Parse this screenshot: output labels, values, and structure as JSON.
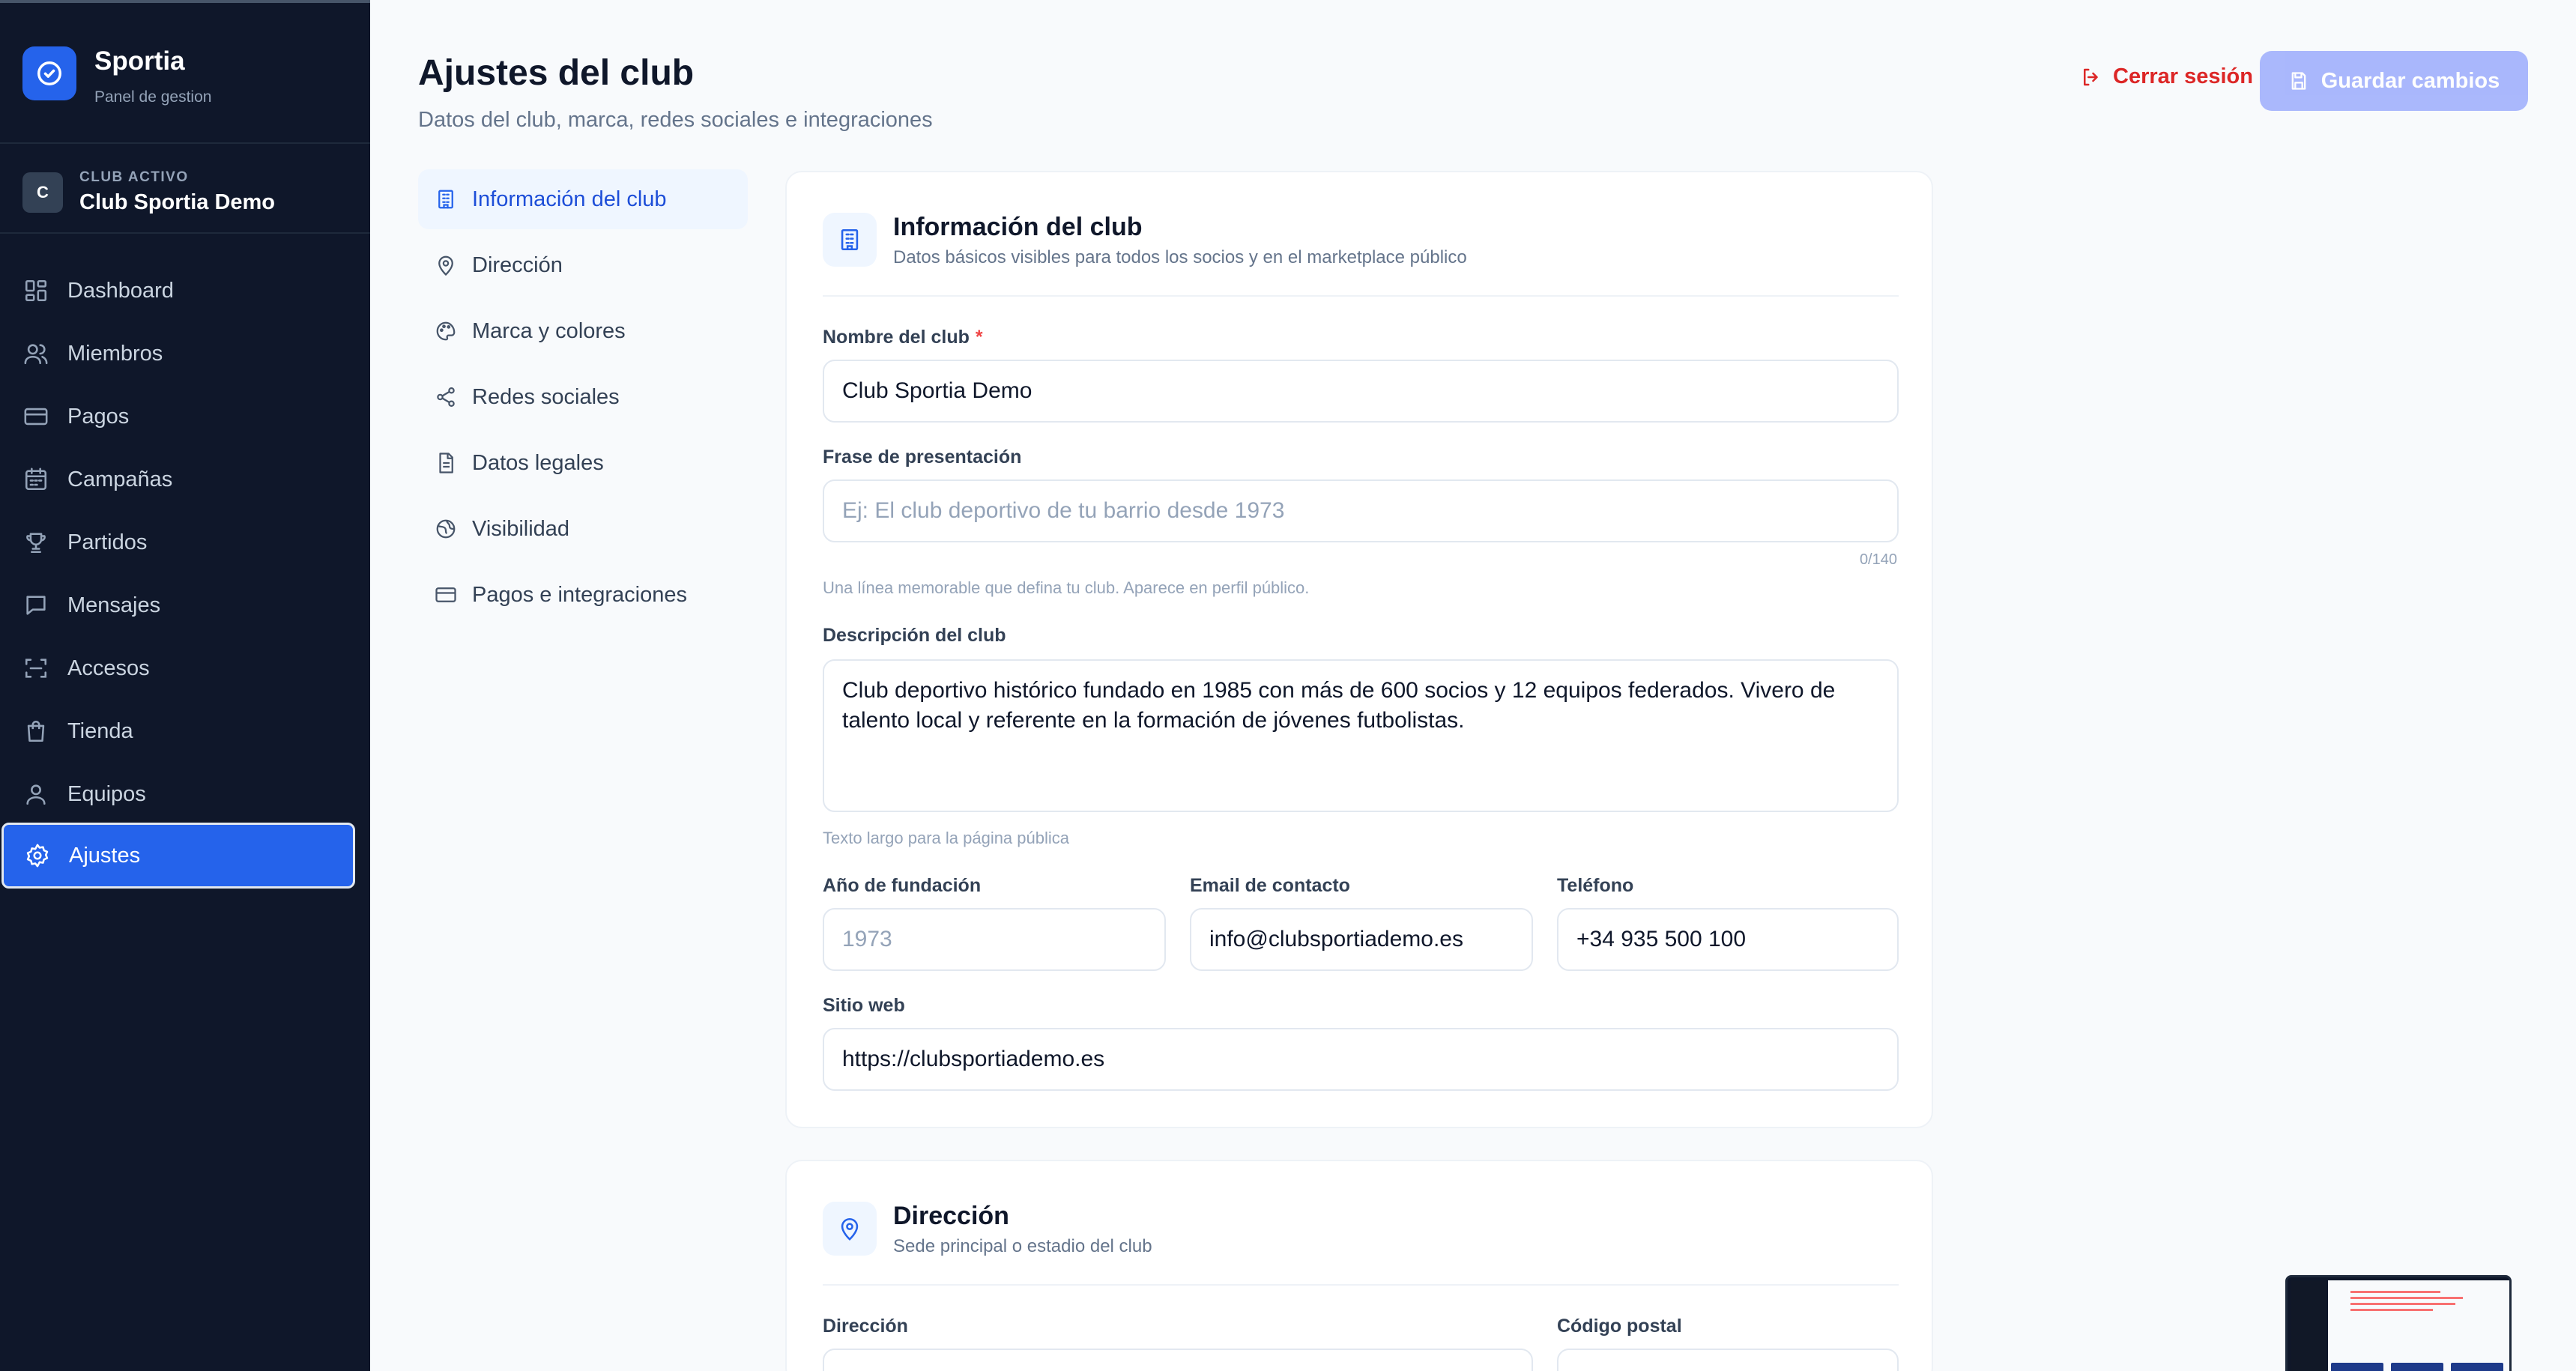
{
  "brand": {
    "name": "Sportia",
    "subtitle": "Panel de gestion"
  },
  "club": {
    "initial": "C",
    "label": "CLUB ACTIVO",
    "name": "Club Sportia Demo"
  },
  "sidebar": {
    "items": [
      {
        "label": "Dashboard",
        "icon": "dashboard-icon"
      },
      {
        "label": "Miembros",
        "icon": "users-icon"
      },
      {
        "label": "Pagos",
        "icon": "credit-card-icon"
      },
      {
        "label": "Campañas",
        "icon": "calendar-icon"
      },
      {
        "label": "Partidos",
        "icon": "trophy-icon"
      },
      {
        "label": "Mensajes",
        "icon": "message-icon"
      },
      {
        "label": "Accesos",
        "icon": "scan-icon"
      },
      {
        "label": "Tienda",
        "icon": "shopping-bag-icon"
      },
      {
        "label": "Equipos",
        "icon": "user-icon"
      },
      {
        "label": "Ajustes",
        "icon": "gear-icon",
        "active": true
      }
    ]
  },
  "header": {
    "title": "Ajustes del club",
    "subtitle": "Datos del club, marca, redes sociales e integraciones",
    "logout_label": "Cerrar sesión",
    "save_label": "Guardar cambios"
  },
  "section_nav": [
    {
      "label": "Información del club",
      "icon": "building-icon",
      "active": true
    },
    {
      "label": "Dirección",
      "icon": "map-pin-icon"
    },
    {
      "label": "Marca y colores",
      "icon": "palette-icon"
    },
    {
      "label": "Redes sociales",
      "icon": "share-icon"
    },
    {
      "label": "Datos legales",
      "icon": "document-icon"
    },
    {
      "label": "Visibilidad",
      "icon": "globe-icon"
    },
    {
      "label": "Pagos e integraciones",
      "icon": "credit-card-icon"
    }
  ],
  "info_card": {
    "title": "Información del club",
    "subtitle": "Datos básicos visibles para todos los socios y en el marketplace público",
    "name_label": "Nombre del club",
    "name_required": "*",
    "name_value": "Club Sportia Demo",
    "tagline_label": "Frase de presentación",
    "tagline_placeholder": "Ej: El club deportivo de tu barrio desde 1973",
    "tagline_count": "0/140",
    "tagline_hint": "Una línea memorable que defina tu club. Aparece en perfil público.",
    "description_label": "Descripción del club",
    "description_value": "Club deportivo histórico fundado en 1985 con más de 600 socios y 12 equipos federados. Vivero de talento local y referente en la formación de jóvenes futbolistas.",
    "description_hint": "Texto largo para la página pública",
    "founded_label": "Año de fundación",
    "founded_placeholder": "1973",
    "email_label": "Email de contacto",
    "email_value": "info@clubsportiademo.es",
    "phone_label": "Teléfono",
    "phone_value": "+34 935 500 100",
    "website_label": "Sitio web",
    "website_value": "https://clubsportiademo.es"
  },
  "address_card": {
    "title": "Dirección",
    "subtitle": "Sede principal o estadio del club",
    "address_label": "Dirección",
    "postal_label": "Código postal"
  },
  "colors": {
    "sidebar_bg": "#0f172a",
    "accent": "#2563eb",
    "danger": "#dc2626",
    "save_disabled": "#a5b4fc"
  }
}
